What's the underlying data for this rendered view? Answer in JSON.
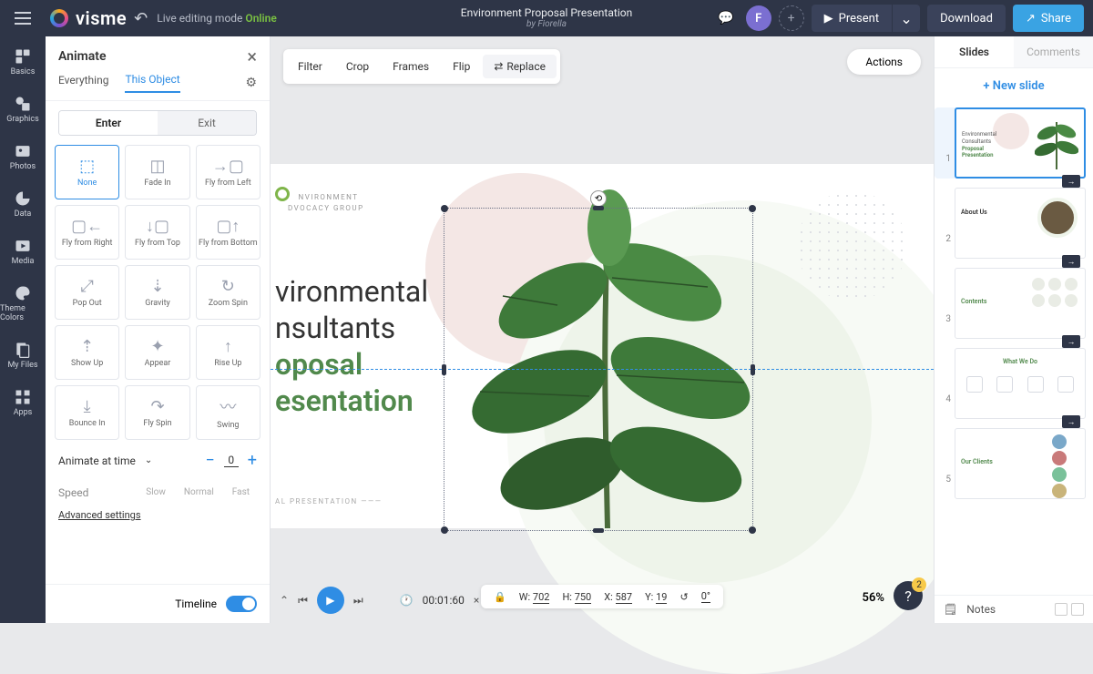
{
  "header": {
    "logo_text": "visme",
    "mode_label": "Live editing mode",
    "mode_status": "Online",
    "doc_title": "Environment Proposal Presentation",
    "doc_author": "by Fiorella",
    "avatar_initial": "F",
    "present": "Present",
    "download": "Download",
    "share": "Share"
  },
  "rail": {
    "items": [
      "Basics",
      "Graphics",
      "Photos",
      "Data",
      "Media",
      "Theme Colors",
      "My Files",
      "Apps"
    ]
  },
  "panel": {
    "title": "Animate",
    "tab_everything": "Everything",
    "tab_this": "This Object",
    "enter": "Enter",
    "exit": "Exit",
    "anims": [
      "None",
      "Fade In",
      "Fly from Left",
      "Fly from Right",
      "Fly from Top",
      "Fly from Bottom",
      "Pop Out",
      "Gravity",
      "Zoom Spin",
      "Show Up",
      "Appear",
      "Rise Up",
      "Bounce In",
      "Fly Spin",
      "Swing"
    ],
    "time_label": "Animate at time",
    "time_value": "0",
    "speed_label": "Speed",
    "speed_opts": [
      "Slow",
      "Normal",
      "Fast"
    ],
    "advanced": "Advanced settings",
    "timeline": "Timeline"
  },
  "image_toolbar": {
    "filter": "Filter",
    "crop": "Crop",
    "frames": "Frames",
    "flip": "Flip",
    "replace": "Replace"
  },
  "actions": "Actions",
  "slide": {
    "hdr_line1": "NVIRONMENT",
    "hdr_line2": "DVOCACY GROUP",
    "t1": "vironmental",
    "t2": "nsultants",
    "t3": "oposal",
    "t4": "esentation",
    "foot": "AL PRESENTATION"
  },
  "status": {
    "w_label": "W:",
    "w": "702",
    "h_label": "H:",
    "h": "750",
    "x_label": "X:",
    "x": "587",
    "y_label": "Y:",
    "y": "19",
    "rot": "0°",
    "zoom": "56%",
    "help_badge": "2"
  },
  "playback": {
    "time": "00:01:60"
  },
  "rpanel": {
    "tab_slides": "Slides",
    "tab_comments": "Comments",
    "new_slide": "New slide",
    "notes": "Notes",
    "th1": {
      "l1": "Environmental",
      "l2": "Consultants",
      "l3": "Proposal",
      "l4": "Presentation"
    },
    "th2": "About Us",
    "th3": "Contents",
    "th4": "What We Do",
    "th5": "Our Clients",
    "nums": [
      "1",
      "2",
      "3",
      "4",
      "5"
    ]
  }
}
